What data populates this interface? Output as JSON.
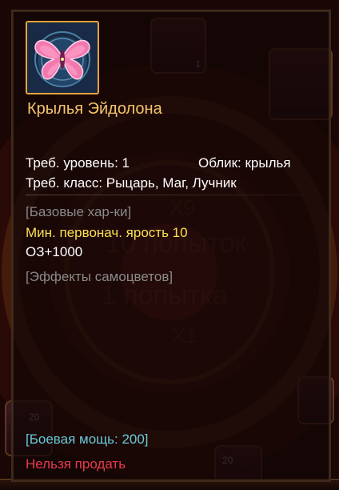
{
  "item": {
    "name": "Крылья Эйдолона",
    "icon": "wings-icon"
  },
  "requirements": {
    "level": "Треб. уровень: 1",
    "appearance": "Облик: крылья",
    "class": "Треб. класс: Рыцарь, Маг, Лучник"
  },
  "base_stats": {
    "header": "[Базовые хар-ки]",
    "rage": "Мин. первонач. ярость 10",
    "hp": "ОЗ+1000"
  },
  "gems": {
    "header": "[Эффекты самоцветов]"
  },
  "combat_power": "[Боевая мощь: 200]",
  "sell_status": "Нельзя продать",
  "background": {
    "x9": "X9",
    "attempts10": "10 попыток",
    "attempts1": "1 попытка",
    "x1": "X1",
    "tile_count": "1",
    "tile_num_a": "20",
    "tile_num_b": "20"
  },
  "colors": {
    "name": "#f5c46b",
    "stat_highlight": "#fbe14f",
    "section_header": "#8a8a8a",
    "combat_power": "#69c9d6",
    "not_sellable": "#e73c4e"
  }
}
